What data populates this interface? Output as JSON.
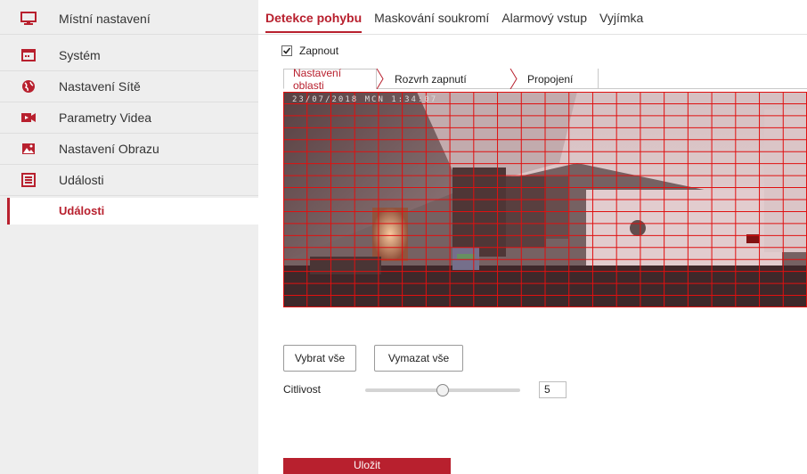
{
  "sidebar": {
    "items": [
      {
        "label": "Místní nastavení",
        "icon": "monitor-icon"
      },
      {
        "label": "Systém",
        "icon": "system-window-icon"
      },
      {
        "label": "Nastavení Sítě",
        "icon": "globe-icon"
      },
      {
        "label": "Parametry Videa",
        "icon": "video-camera-icon"
      },
      {
        "label": "Nastavení Obrazu",
        "icon": "image-icon"
      },
      {
        "label": "Události",
        "icon": "events-list-icon"
      }
    ],
    "sub_item": {
      "label": "Události"
    }
  },
  "tabs": [
    {
      "label": "Detekce pohybu",
      "active": true
    },
    {
      "label": "Maskování soukromí",
      "active": false
    },
    {
      "label": "Alarmový vstup",
      "active": false
    },
    {
      "label": "Vyjímka",
      "active": false
    }
  ],
  "enable": {
    "label": "Zapnout",
    "checked": true
  },
  "steps": [
    {
      "label": "Nastavení oblasti",
      "active": true
    },
    {
      "label": "Rozvrh zapnutí",
      "active": false
    },
    {
      "label": "Propojení",
      "active": false
    }
  ],
  "video": {
    "osd_text": "23/07/2018 MCN  1:34:07"
  },
  "buttons": {
    "select_all": "Vybrat vše",
    "clear_all": "Vymazat vše",
    "save": "Uložit"
  },
  "sensitivity": {
    "label": "Citlivost",
    "value": "5",
    "slider_fraction": 0.5
  },
  "colors": {
    "accent": "#b8202e",
    "grid": "#e01010"
  }
}
